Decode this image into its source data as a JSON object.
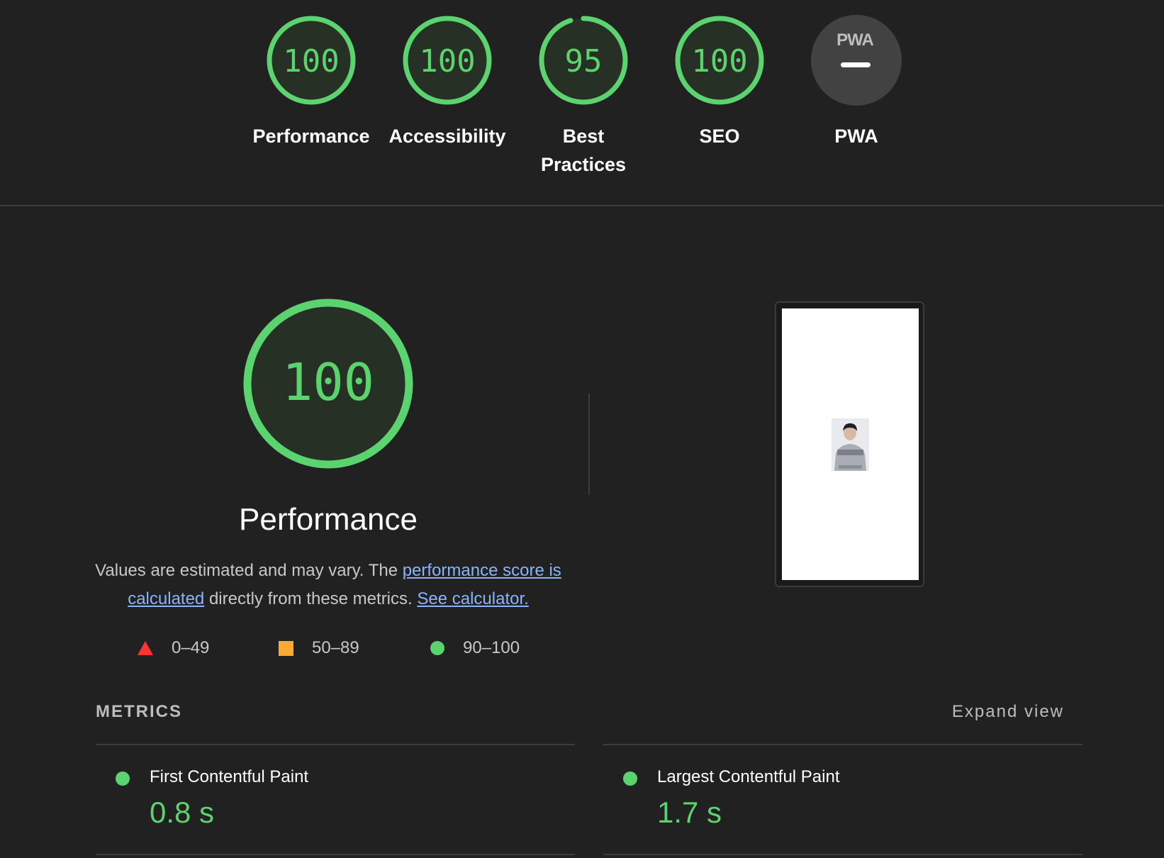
{
  "gauges": [
    {
      "score": "100",
      "label": "Performance",
      "value": 100
    },
    {
      "score": "100",
      "label": "Accessibility",
      "value": 100
    },
    {
      "score": "95",
      "label": "Best Practices",
      "label_line1": "Best",
      "label_line2": "Practices",
      "value": 95
    },
    {
      "score": "100",
      "label": "SEO",
      "value": 100
    },
    {
      "score": "",
      "label": "PWA",
      "badge": "PWA"
    }
  ],
  "performance": {
    "score": "100",
    "value": 100,
    "title": "Performance",
    "desc_text1": "Values are estimated and may vary. The ",
    "desc_link1": "performance score is calculated",
    "desc_text2": " directly from these metrics. ",
    "desc_link2": "See calculator."
  },
  "legend": [
    {
      "shape": "triangle",
      "label": "0–49",
      "color": "#ff3333"
    },
    {
      "shape": "square",
      "label": "50–89",
      "color": "#ffaa33"
    },
    {
      "shape": "circle",
      "label": "90–100",
      "color": "#5bd46f"
    }
  ],
  "metrics": {
    "heading": "METRICS",
    "expand": "Expand view",
    "items": [
      {
        "name": "First Contentful Paint",
        "value": "0.8 s"
      },
      {
        "name": "Largest Contentful Paint",
        "value": "1.7 s"
      }
    ]
  },
  "colors": {
    "pass": "#5bd46f",
    "bg": "#212121",
    "gauge_fill": "#263024",
    "pwa_bg": "#424242"
  }
}
